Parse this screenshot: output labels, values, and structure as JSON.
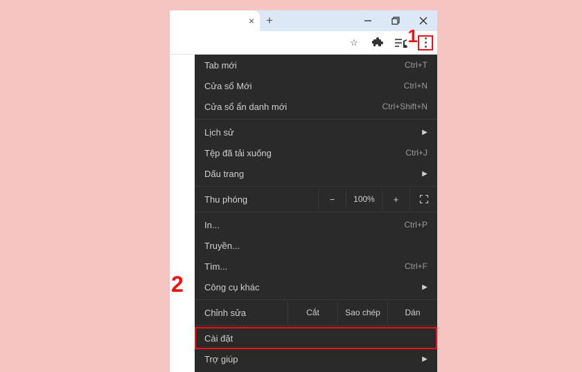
{
  "callouts": {
    "one": "1",
    "two": "2"
  },
  "tabstrip": {
    "close_glyph": "×",
    "new_tab_glyph": "+"
  },
  "window_controls": {
    "minimize": "—",
    "maximize": "❐",
    "close": "×"
  },
  "toolbar": {
    "star": "☆",
    "ext_puzzle": "puzzle-icon",
    "list": "media-control-icon",
    "kebab": "more-icon"
  },
  "menu": {
    "new_tab": {
      "label": "Tab mới",
      "shortcut": "Ctrl+T"
    },
    "new_window": {
      "label": "Cửa sổ Mới",
      "shortcut": "Ctrl+N"
    },
    "incognito": {
      "label": "Cửa sổ ẩn danh mới",
      "shortcut": "Ctrl+Shift+N"
    },
    "history": {
      "label": "Lịch sử"
    },
    "downloads": {
      "label": "Tệp đã tải xuống",
      "shortcut": "Ctrl+J"
    },
    "bookmarks": {
      "label": "Dấu trang"
    },
    "zoom": {
      "label": "Thu phóng",
      "minus": "−",
      "value": "100%",
      "plus": "+"
    },
    "print": {
      "label": "In...",
      "shortcut": "Ctrl+P"
    },
    "cast": {
      "label": "Truyền..."
    },
    "find": {
      "label": "Tìm...",
      "shortcut": "Ctrl+F"
    },
    "more_tools": {
      "label": "Công cụ khác"
    },
    "edit": {
      "label": "Chỉnh sửa",
      "cut": "Cắt",
      "copy": "Sao chép",
      "paste": "Dán"
    },
    "settings": {
      "label": "Cài đặt"
    },
    "help": {
      "label": "Trợ giúp"
    }
  }
}
